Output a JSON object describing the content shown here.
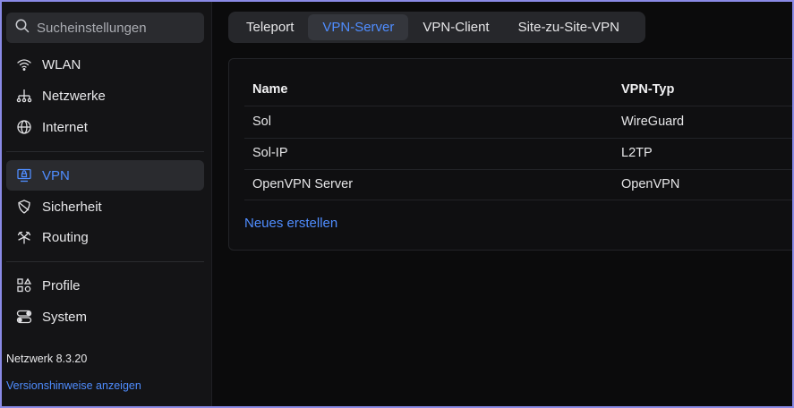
{
  "sidebar": {
    "search_placeholder": "Sucheinstellungen",
    "items": [
      {
        "label": "WLAN",
        "icon": "wifi-icon"
      },
      {
        "label": "Netzwerke",
        "icon": "network-icon"
      },
      {
        "label": "Internet",
        "icon": "globe-icon"
      },
      {
        "label": "VPN",
        "icon": "vpn-icon",
        "active": true
      },
      {
        "label": "Sicherheit",
        "icon": "shield-icon"
      },
      {
        "label": "Routing",
        "icon": "routing-icon"
      },
      {
        "label": "Profile",
        "icon": "profiles-icon"
      },
      {
        "label": "System",
        "icon": "toggle-icon"
      }
    ],
    "version": "Netzwerk 8.3.20",
    "release_notes_link": "Versionshinweise anzeigen"
  },
  "tabs": [
    {
      "label": "Teleport"
    },
    {
      "label": "VPN-Server",
      "active": true
    },
    {
      "label": "VPN-Client"
    },
    {
      "label": "Site-zu-Site-VPN"
    }
  ],
  "table": {
    "headers": [
      "Name",
      "VPN-Typ"
    ],
    "rows": [
      [
        "Sol",
        "WireGuard"
      ],
      [
        "Sol-IP",
        "L2TP"
      ],
      [
        "OpenVPN Server",
        "OpenVPN"
      ]
    ],
    "create_link": "Neues erstellen"
  },
  "colors": {
    "accent": "#4f8dff",
    "background": "#0b0b0c",
    "sidebar": "#141416"
  }
}
